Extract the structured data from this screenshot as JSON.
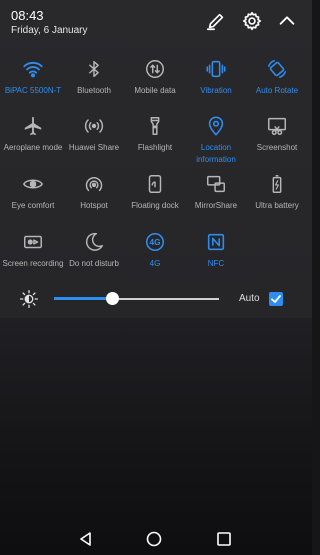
{
  "status": {
    "time": "08:43",
    "date": "Friday, 6 January"
  },
  "header_icons": [
    "edit-icon",
    "gear-icon",
    "chevron-up-icon"
  ],
  "colors": {
    "accent": "#2e8ef0",
    "inactive": "#b6b6b6"
  },
  "tiles": [
    {
      "label": "BiPAC 5500N-T",
      "icon": "wifi-icon",
      "active": true
    },
    {
      "label": "Bluetooth",
      "icon": "bluetooth-icon",
      "active": false
    },
    {
      "label": "Mobile data",
      "icon": "mobile-data-icon",
      "active": false
    },
    {
      "label": "Vibration",
      "icon": "vibration-icon",
      "active": true
    },
    {
      "label": "Auto Rotate",
      "icon": "auto-rotate-icon",
      "active": true
    },
    {
      "label": "Aeroplane mode",
      "icon": "aeroplane-icon",
      "active": false
    },
    {
      "label": "Huawei Share",
      "icon": "huawei-share-icon",
      "active": false
    },
    {
      "label": "Flashlight",
      "icon": "flashlight-icon",
      "active": false
    },
    {
      "label": "Location information",
      "icon": "location-icon",
      "active": true
    },
    {
      "label": "Screenshot",
      "icon": "screenshot-icon",
      "active": false
    },
    {
      "label": "Eye comfort",
      "icon": "eye-icon",
      "active": false
    },
    {
      "label": "Hotspot",
      "icon": "hotspot-icon",
      "active": false
    },
    {
      "label": "Floating dock",
      "icon": "floating-dock-icon",
      "active": false
    },
    {
      "label": "MirrorShare",
      "icon": "mirrorshare-icon",
      "active": false
    },
    {
      "label": "Ultra battery",
      "icon": "battery-icon",
      "active": false
    },
    {
      "label": "Screen recording",
      "icon": "screen-recording-icon",
      "active": false
    },
    {
      "label": "Do not disturb",
      "icon": "moon-icon",
      "active": false
    },
    {
      "label": "4G",
      "icon": "4g-icon",
      "active": true
    },
    {
      "label": "NFC",
      "icon": "nfc-icon",
      "active": true
    }
  ],
  "brightness": {
    "level": 0.35,
    "auto_label": "Auto",
    "auto_checked": true
  },
  "navbar": [
    "back-icon",
    "home-icon",
    "recents-icon"
  ]
}
